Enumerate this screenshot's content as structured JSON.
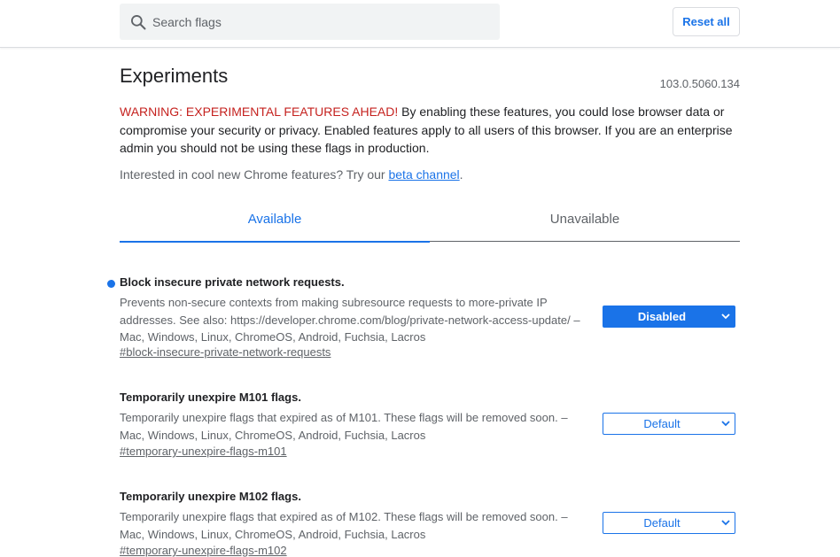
{
  "search": {
    "placeholder": "Search flags"
  },
  "header": {
    "reset_label": "Reset all"
  },
  "page": {
    "title": "Experiments",
    "version": "103.0.5060.134"
  },
  "warning": {
    "strong": "WARNING: EXPERIMENTAL FEATURES AHEAD!",
    "text": " By enabling these features, you could lose browser data or compromise your security or privacy. Enabled features apply to all users of this browser. If you are an enterprise admin you should not be using these flags in production."
  },
  "interest": {
    "prefix": "Interested in cool new Chrome features? Try our ",
    "link": "beta channel",
    "suffix": "."
  },
  "tabs": [
    {
      "label": "Available",
      "selected": true
    },
    {
      "label": "Unavailable",
      "selected": false
    }
  ],
  "flags": [
    {
      "name": "Block insecure private network requests.",
      "description": "Prevents non-secure contexts from making subresource requests to more-private IP addresses. See also: https://developer.chrome.com/blog/private-network-access-update/ – Mac, Windows, Linux, ChromeOS, Android, Fuchsia, Lacros",
      "link": "#block-insecure-private-network-requests",
      "value": "Disabled",
      "modified": true
    },
    {
      "name": "Temporarily unexpire M101 flags.",
      "description": "Temporarily unexpire flags that expired as of M101. These flags will be removed soon. – Mac, Windows, Linux, ChromeOS, Android, Fuchsia, Lacros",
      "link": "#temporary-unexpire-flags-m101",
      "value": "Default",
      "modified": false
    },
    {
      "name": "Temporarily unexpire M102 flags.",
      "description": "Temporarily unexpire flags that expired as of M102. These flags will be removed soon. – Mac, Windows, Linux, ChromeOS, Android, Fuchsia, Lacros",
      "link": "#temporary-unexpire-flags-m102",
      "value": "Default",
      "modified": false
    }
  ],
  "colors": {
    "accent": "#1a73e8",
    "warning": "#c5221f",
    "text": "#202124",
    "secondary": "#5f6368"
  }
}
